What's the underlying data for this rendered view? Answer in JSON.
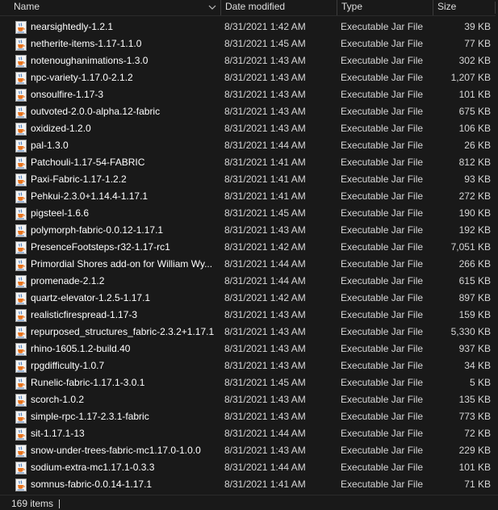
{
  "columns": {
    "name": "Name",
    "date": "Date modified",
    "type": "Type",
    "size": "Size"
  },
  "sort": {
    "column": "name",
    "direction": "ascending",
    "icon": "chevron-down-icon"
  },
  "file_icon": "java-jar-icon",
  "files": [
    {
      "name": "nearsightedly-1.2.1",
      "date": "8/31/2021 1:42 AM",
      "type": "Executable Jar File",
      "size": "39 KB"
    },
    {
      "name": "netherite-items-1.17-1.1.0",
      "date": "8/31/2021 1:45 AM",
      "type": "Executable Jar File",
      "size": "77 KB"
    },
    {
      "name": "notenoughanimations-1.3.0",
      "date": "8/31/2021 1:43 AM",
      "type": "Executable Jar File",
      "size": "302 KB"
    },
    {
      "name": "npc-variety-1.17.0-2.1.2",
      "date": "8/31/2021 1:43 AM",
      "type": "Executable Jar File",
      "size": "1,207 KB"
    },
    {
      "name": "onsoulfire-1.17-3",
      "date": "8/31/2021 1:43 AM",
      "type": "Executable Jar File",
      "size": "101 KB"
    },
    {
      "name": "outvoted-2.0.0-alpha.12-fabric",
      "date": "8/31/2021 1:43 AM",
      "type": "Executable Jar File",
      "size": "675 KB"
    },
    {
      "name": "oxidized-1.2.0",
      "date": "8/31/2021 1:43 AM",
      "type": "Executable Jar File",
      "size": "106 KB"
    },
    {
      "name": "pal-1.3.0",
      "date": "8/31/2021 1:44 AM",
      "type": "Executable Jar File",
      "size": "26 KB"
    },
    {
      "name": "Patchouli-1.17-54-FABRIC",
      "date": "8/31/2021 1:41 AM",
      "type": "Executable Jar File",
      "size": "812 KB"
    },
    {
      "name": "Paxi-Fabric-1.17-1.2.2",
      "date": "8/31/2021 1:41 AM",
      "type": "Executable Jar File",
      "size": "93 KB"
    },
    {
      "name": "Pehkui-2.3.0+1.14.4-1.17.1",
      "date": "8/31/2021 1:41 AM",
      "type": "Executable Jar File",
      "size": "272 KB"
    },
    {
      "name": "pigsteel-1.6.6",
      "date": "8/31/2021 1:45 AM",
      "type": "Executable Jar File",
      "size": "190 KB"
    },
    {
      "name": "polymorph-fabric-0.0.12-1.17.1",
      "date": "8/31/2021 1:43 AM",
      "type": "Executable Jar File",
      "size": "192 KB"
    },
    {
      "name": "PresenceFootsteps-r32-1.17-rc1",
      "date": "8/31/2021 1:42 AM",
      "type": "Executable Jar File",
      "size": "7,051 KB"
    },
    {
      "name": "Primordial Shores add-on for William Wy...",
      "date": "8/31/2021 1:44 AM",
      "type": "Executable Jar File",
      "size": "266 KB"
    },
    {
      "name": "promenade-2.1.2",
      "date": "8/31/2021 1:44 AM",
      "type": "Executable Jar File",
      "size": "615 KB"
    },
    {
      "name": "quartz-elevator-1.2.5-1.17.1",
      "date": "8/31/2021 1:42 AM",
      "type": "Executable Jar File",
      "size": "897 KB"
    },
    {
      "name": "realisticfirespread-1.17-3",
      "date": "8/31/2021 1:43 AM",
      "type": "Executable Jar File",
      "size": "159 KB"
    },
    {
      "name": "repurposed_structures_fabric-2.3.2+1.17.1",
      "date": "8/31/2021 1:43 AM",
      "type": "Executable Jar File",
      "size": "5,330 KB"
    },
    {
      "name": "rhino-1605.1.2-build.40",
      "date": "8/31/2021 1:43 AM",
      "type": "Executable Jar File",
      "size": "937 KB"
    },
    {
      "name": "rpgdifficulty-1.0.7",
      "date": "8/31/2021 1:43 AM",
      "type": "Executable Jar File",
      "size": "34 KB"
    },
    {
      "name": "Runelic-fabric-1.17.1-3.0.1",
      "date": "8/31/2021 1:45 AM",
      "type": "Executable Jar File",
      "size": "5 KB"
    },
    {
      "name": "scorch-1.0.2",
      "date": "8/31/2021 1:43 AM",
      "type": "Executable Jar File",
      "size": "135 KB"
    },
    {
      "name": "simple-rpc-1.17-2.3.1-fabric",
      "date": "8/31/2021 1:43 AM",
      "type": "Executable Jar File",
      "size": "773 KB"
    },
    {
      "name": "sit-1.17.1-13",
      "date": "8/31/2021 1:44 AM",
      "type": "Executable Jar File",
      "size": "72 KB"
    },
    {
      "name": "snow-under-trees-fabric-mc1.17.0-1.0.0",
      "date": "8/31/2021 1:43 AM",
      "type": "Executable Jar File",
      "size": "229 KB"
    },
    {
      "name": "sodium-extra-mc1.17.1-0.3.3",
      "date": "8/31/2021 1:44 AM",
      "type": "Executable Jar File",
      "size": "101 KB"
    },
    {
      "name": "somnus-fabric-0.0.14-1.17.1",
      "date": "8/31/2021 1:41 AM",
      "type": "Executable Jar File",
      "size": "71 KB"
    }
  ],
  "status": {
    "item_count": "169 items"
  },
  "colors": {
    "background": "#191919",
    "text": "#ffffff",
    "secondary_text": "#d6d6d6",
    "java_cup": "#e8731c",
    "java_steam": "#3a72b8"
  }
}
